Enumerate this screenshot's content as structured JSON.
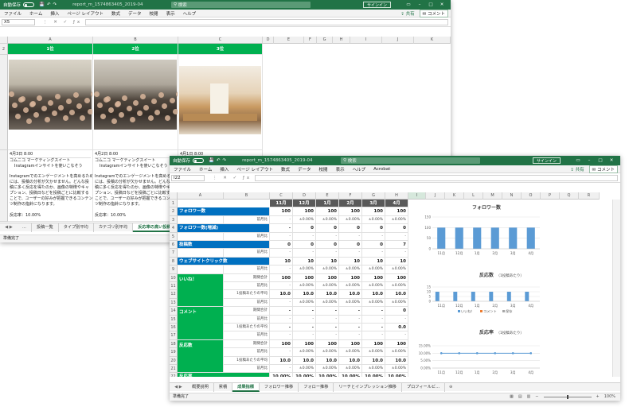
{
  "win1": {
    "autosave": "自動保存",
    "file_name": "report_m_1574863405_2019-04",
    "search": "検索",
    "signin": "サインイン",
    "tabs": [
      "ファイル",
      "ホーム",
      "挿入",
      "ページ レイアウト",
      "数式",
      "データ",
      "校閲",
      "表示",
      "ヘルプ"
    ],
    "share": "共有",
    "comment": "コメント",
    "name_box": "X5",
    "cols": [
      "A",
      "B",
      "C",
      "D",
      "E",
      "F",
      "G",
      "H",
      "I",
      "J",
      "K"
    ],
    "rank_labels": [
      "1位",
      "2位",
      "3位"
    ],
    "posts": [
      {
        "date": "4月3日 8:00",
        "line1": "コムニコ マーケティングスイート",
        "line2": "Instagramインサイトを使いこなそう"
      },
      {
        "date": "4月2日 8:00",
        "line1": "コムニコ マーケティングスイート",
        "line2": "Instagramインサイトを使いこなそう"
      },
      {
        "date": "4月1日 8:00",
        "line1": "コムニコ マーケティングスイート",
        "line2": ""
      }
    ],
    "body_text": [
      "Instagramでのエンゲージメントを高めるため",
      "には、投稿の分析が欠かせません。どんな投",
      "稿に多く反応を得たのか、画像の特徴やキャ",
      "プション、投稿日などを投稿ごとに比較する",
      "ことで、ユーザーの好みが把握できるコンテン",
      "ツ制作の指針になります。"
    ],
    "body_text2": [
      "Instagramでのエンゲージメントを高めるため",
      "には、投稿の分析が欠かせません。どんな投",
      "稿に多く反応を得たのか、画像の特徴やキャ",
      "プション、投稿日などを投稿ごとに比較する",
      "ことで、ユーザーの好みが把握できるコンテン",
      "ツ制作の指針になります。"
    ],
    "reaction_rate": "反応率：10.00%",
    "reaction_rate2": "反応率：10.00%",
    "sheets": [
      "...",
      "投稿一覧",
      "タイプ別平均",
      "カテゴリ別平均",
      "反応率の高い投稿"
    ],
    "active_sheet": 4,
    "status": "準備完了"
  },
  "win2": {
    "autosave": "自動保存",
    "file_name": "report_m_1574863405_2019-04",
    "search": "検索",
    "signin": "サインイン",
    "tabs": [
      "ファイル",
      "ホーム",
      "挿入",
      "ページ レイアウト",
      "数式",
      "データ",
      "校閲",
      "表示",
      "ヘルプ",
      "Acrobat"
    ],
    "share": "共有",
    "comment": "コメント",
    "name_box": "I22",
    "cols": [
      "A",
      "B",
      "C",
      "D",
      "E",
      "F",
      "G",
      "H",
      "I",
      "J",
      "K",
      "L",
      "M",
      "N",
      "O",
      "P",
      "Q",
      "R"
    ],
    "months": [
      "11月",
      "12月",
      "1月",
      "2月",
      "3月",
      "4月"
    ],
    "row_numbers": [
      "1",
      "2",
      "3",
      "4",
      "5",
      "6",
      "7",
      "8",
      "9",
      "10",
      "11",
      "12",
      "13",
      "14",
      "15",
      "16",
      "17",
      "18",
      "19",
      "20",
      "21",
      "22"
    ],
    "rows": [
      {
        "r": 2,
        "label": "フォロワー数",
        "kind": "blue",
        "vals": [
          "100",
          "100",
          "100",
          "100",
          "100",
          "100"
        ]
      },
      {
        "r": 3,
        "sub": "前月比",
        "vals": [
          "-",
          "±0.00%",
          "±0.00%",
          "±0.00%",
          "±0.00%",
          "±0.00%"
        ]
      },
      {
        "r": 4,
        "label": "フォロワー数(増減)",
        "kind": "blue",
        "vals": [
          "-",
          "0",
          "0",
          "0",
          "0",
          "0"
        ]
      },
      {
        "r": 5,
        "sub": "前月比",
        "vals": [
          "-",
          "-",
          "-",
          "-",
          "-",
          "-"
        ]
      },
      {
        "r": 6,
        "label": "投稿数",
        "kind": "blue",
        "vals": [
          "0",
          "0",
          "0",
          "0",
          "0",
          "7"
        ]
      },
      {
        "r": 7,
        "sub": "前月比",
        "vals": [
          "-",
          "-",
          "-",
          "-",
          "-",
          "-"
        ]
      },
      {
        "r": 8,
        "label": "ウェブサイトクリック数",
        "kind": "blue",
        "vals": [
          "10",
          "10",
          "10",
          "10",
          "10",
          "10"
        ]
      },
      {
        "r": 9,
        "sub": "前月比",
        "vals": [
          "-",
          "±0.00%",
          "±0.00%",
          "±0.00%",
          "±0.00%",
          "±0.00%"
        ]
      },
      {
        "r": 10,
        "sub": "期間合計",
        "vals": [
          "100",
          "100",
          "100",
          "100",
          "100",
          "100"
        ]
      },
      {
        "r": 11,
        "sub": "前月比",
        "vals": [
          "-",
          "±0.00%",
          "±0.00%",
          "±0.00%",
          "±0.00%",
          "±0.00%"
        ]
      },
      {
        "r": 12,
        "sub": "1投稿あたりの平均",
        "vals": [
          "10.0",
          "10.0",
          "10.0",
          "10.0",
          "10.0",
          "10.0"
        ]
      },
      {
        "r": 13,
        "sub": "前月比",
        "vals": [
          "-",
          "±0.00%",
          "±0.00%",
          "±0.00%",
          "±0.00%",
          "±0.00%"
        ]
      },
      {
        "r": 14,
        "sub": "期間合計",
        "vals": [
          "-",
          "-",
          "-",
          "-",
          "-",
          "0"
        ]
      },
      {
        "r": 15,
        "sub": "前月比",
        "vals": [
          "-",
          "-",
          "-",
          "-",
          "-",
          "-"
        ]
      },
      {
        "r": 16,
        "sub": "1投稿あたりの平均",
        "vals": [
          "-",
          "-",
          "-",
          "-",
          "-",
          "0.0"
        ]
      },
      {
        "r": 17,
        "sub": "前月比",
        "vals": [
          "-",
          "-",
          "-",
          "-",
          "-",
          "-"
        ]
      },
      {
        "r": 18,
        "sub": "期間合計",
        "vals": [
          "100",
          "100",
          "100",
          "100",
          "100",
          "100"
        ]
      },
      {
        "r": 19,
        "sub": "前月比",
        "vals": [
          "-",
          "±0.00%",
          "±0.00%",
          "±0.00%",
          "±0.00%",
          "±0.00%"
        ]
      },
      {
        "r": 20,
        "sub": "1投稿あたりの平均",
        "vals": [
          "10.0",
          "10.0",
          "10.0",
          "10.0",
          "10.0",
          "10.0"
        ]
      },
      {
        "r": 21,
        "sub": "前月比",
        "vals": [
          "-",
          "±0.00%",
          "±0.00%",
          "±0.00%",
          "±0.00%",
          "±0.00%"
        ]
      },
      {
        "r": 22,
        "label": "反応率",
        "kind": "green",
        "vals": [
          "10.00%",
          "10.00%",
          "10.00%",
          "10.00%",
          "10.00%",
          "10.00%"
        ]
      }
    ],
    "groups": [
      {
        "label": "いいね！",
        "start": 10,
        "end": 13
      },
      {
        "label": "コメント",
        "start": 14,
        "end": 17
      },
      {
        "label": "反応数",
        "start": 18,
        "end": 21
      }
    ],
    "sheets": [
      "概要説明",
      "累積",
      "成果指標",
      "フォロワー推移",
      "フォロー推移",
      "リーチとインプレッション推移",
      "プロフィールビ..."
    ],
    "active_sheet": 2,
    "status": "準備完了",
    "zoom": "100%"
  },
  "chart_data": [
    {
      "type": "bar",
      "title": "フォロワー数",
      "categories": [
        "11月",
        "12月",
        "1月",
        "2月",
        "3月",
        "4月"
      ],
      "values": [
        100,
        100,
        100,
        100,
        100,
        100
      ],
      "ylim": [
        0,
        150
      ],
      "yticks": [
        "0",
        "50",
        "100",
        "150"
      ],
      "color": "#5b9bd5"
    },
    {
      "type": "bar",
      "title": "反応数",
      "subtitle": "（1投稿あたり）",
      "categories": [
        "11月",
        "12月",
        "1月",
        "2月",
        "3月",
        "4月"
      ],
      "series": [
        {
          "name": "いいね！",
          "values": [
            10,
            10,
            10,
            10,
            10,
            10
          ],
          "color": "#5b9bd5"
        },
        {
          "name": "コメント",
          "values": [
            0,
            0,
            0,
            0,
            0,
            0
          ],
          "color": "#ed7d31"
        },
        {
          "name": "保存",
          "values": [
            0,
            0,
            0,
            0,
            0,
            0
          ],
          "color": "#a5a5a5"
        }
      ],
      "ylim": [
        0,
        15
      ],
      "yticks": [
        "0",
        "5",
        "10",
        "15"
      ]
    },
    {
      "type": "line",
      "title": "反応率",
      "subtitle": "（1投稿あたり）",
      "categories": [
        "11月",
        "12月",
        "1月",
        "2月",
        "3月",
        "4月"
      ],
      "values": [
        10,
        10,
        10,
        10,
        10,
        10
      ],
      "ylim": [
        0,
        15
      ],
      "yticks": [
        "0.00%",
        "5.00%",
        "10.00%",
        "15.00%"
      ],
      "color": "#5b9bd5"
    }
  ],
  "colors": {
    "excel_green": "#217346",
    "header_blue": "#0070c0",
    "label_green": "#00b050"
  }
}
